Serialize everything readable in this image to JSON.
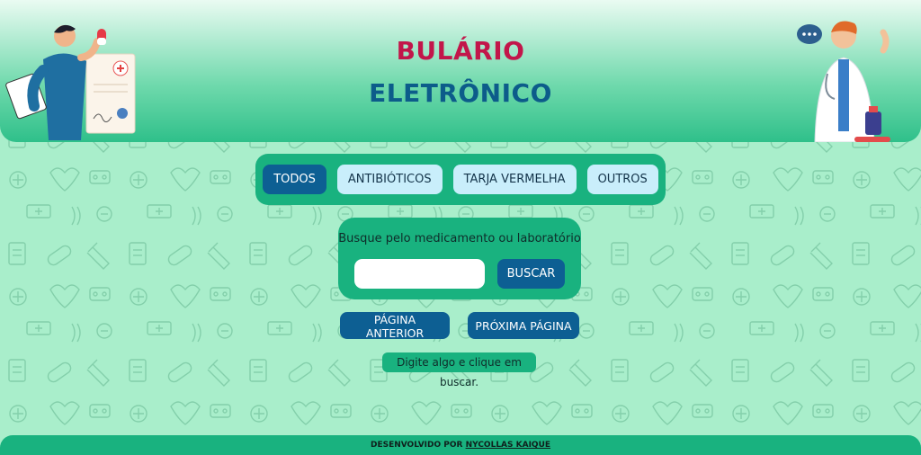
{
  "header": {
    "title_line1": "BULÁRIO",
    "title_line2": "ELETRÔNICO"
  },
  "filters": [
    {
      "label": "TODOS",
      "active": true
    },
    {
      "label": "ANTIBIÓTICOS",
      "active": false
    },
    {
      "label": "TARJA VERMELHA",
      "active": false
    },
    {
      "label": "OUTROS",
      "active": false
    }
  ],
  "search": {
    "label": "Busque pelo medicamento ou laboratório",
    "value": "",
    "button_label": "BUSCAR"
  },
  "pagination": {
    "prev_label": "PÁGINA ANTERIOR",
    "next_label": "PRÓXIMA PÁGINA"
  },
  "status": {
    "message": "Digite algo e clique em buscar."
  },
  "footer": {
    "prefix": "DESENVOLVIDO POR",
    "author": "NYCOLLAS KAIQUE"
  },
  "colors": {
    "page_bg": "#a9eecb",
    "panel": "#19b27f",
    "primary_button": "#0d5f93",
    "secondary_button": "#c9eefb",
    "title_red": "#c2164a",
    "title_blue": "#0c5c8a"
  }
}
